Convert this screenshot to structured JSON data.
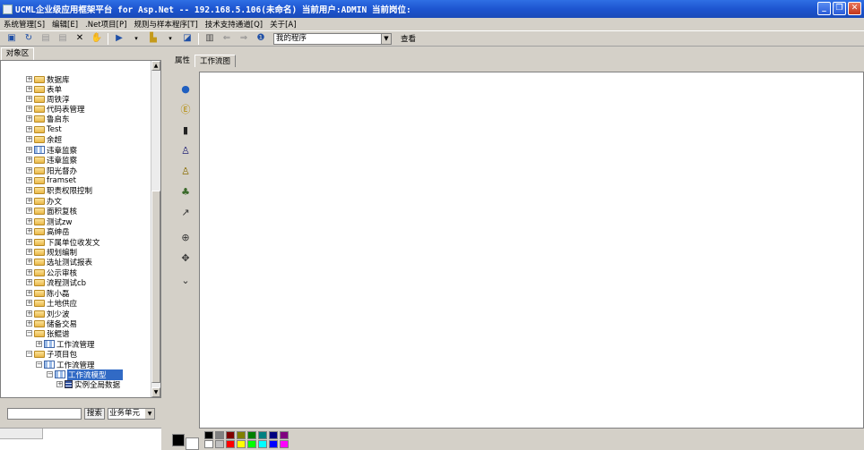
{
  "window": {
    "title": "UCML企业级应用框架平台 for Asp.Net -- 192.168.5.106(未命名) 当前用户:ADMIN 当前岗位:",
    "controls": [
      "_",
      "❐",
      "✕"
    ]
  },
  "menu": [
    "系统管理[S]",
    "编辑[E]",
    ".Net项目[P]",
    "规则与样本程序[T]",
    "技术支持通道[Q]",
    "关于[A]"
  ],
  "toolbar": {
    "program_select": "我的程序",
    "view_button": "查看"
  },
  "left_tab": "对象区",
  "tree": [
    {
      "label": "数据库",
      "icon": "folder"
    },
    {
      "label": "表单",
      "icon": "folder"
    },
    {
      "label": "周铁淳",
      "icon": "folder"
    },
    {
      "label": "代码表管理",
      "icon": "folder"
    },
    {
      "label": "鲁启东",
      "icon": "folder"
    },
    {
      "label": "Test",
      "icon": "folder"
    },
    {
      "label": "余超",
      "icon": "folder"
    },
    {
      "label": "违章监察",
      "icon": "flow"
    },
    {
      "label": "违章监察",
      "icon": "folder"
    },
    {
      "label": "阳光督办",
      "icon": "folder"
    },
    {
      "label": "framset",
      "icon": "folder"
    },
    {
      "label": "职责权限控制",
      "icon": "folder"
    },
    {
      "label": "办文",
      "icon": "folder"
    },
    {
      "label": "面积复核",
      "icon": "folder"
    },
    {
      "label": "测试zw",
      "icon": "folder"
    },
    {
      "label": "高绅岳",
      "icon": "folder"
    },
    {
      "label": "下属单位收发文",
      "icon": "folder"
    },
    {
      "label": "规划编制",
      "icon": "folder"
    },
    {
      "label": "选址测试报表",
      "icon": "folder"
    },
    {
      "label": "公示审核",
      "icon": "folder"
    },
    {
      "label": "流程测试cb",
      "icon": "folder"
    },
    {
      "label": "陈小磊",
      "icon": "folder"
    },
    {
      "label": "土地供应",
      "icon": "folder"
    },
    {
      "label": "刘少波",
      "icon": "folder"
    },
    {
      "label": "储备交易",
      "icon": "folder"
    },
    {
      "label": "张鲲谱",
      "icon": "folder"
    },
    {
      "label": "工作流管理",
      "icon": "flow"
    },
    {
      "label": "子项目包",
      "icon": "folder"
    },
    {
      "label": "工作流管理",
      "icon": "flow"
    },
    {
      "label": "工作流模型",
      "icon": "flow"
    },
    {
      "label": "实例全局数据",
      "icon": "data"
    }
  ],
  "search": {
    "button": "搜索",
    "scope": "业务单元"
  },
  "right_tabs": [
    "属性",
    "工作流图"
  ],
  "tools": [
    "start-icon",
    "end-icon",
    "activity-icon",
    "user-task-icon",
    "warning-task-icon",
    "subflow-icon",
    "connector-icon",
    "zoom-icon",
    "pan-icon",
    "collapse-icon"
  ],
  "colors": {
    "foreground": "#000000",
    "background": "#ffffff",
    "swatches": [
      "#000000",
      "#808080",
      "#800000",
      "#808000",
      "#008000",
      "#008080",
      "#000080",
      "#800080",
      "#ffffff",
      "#c0c0c0",
      "#ff0000",
      "#ffff00",
      "#00ff00",
      "#00ffff",
      "#0000ff",
      "#ff00ff"
    ]
  }
}
